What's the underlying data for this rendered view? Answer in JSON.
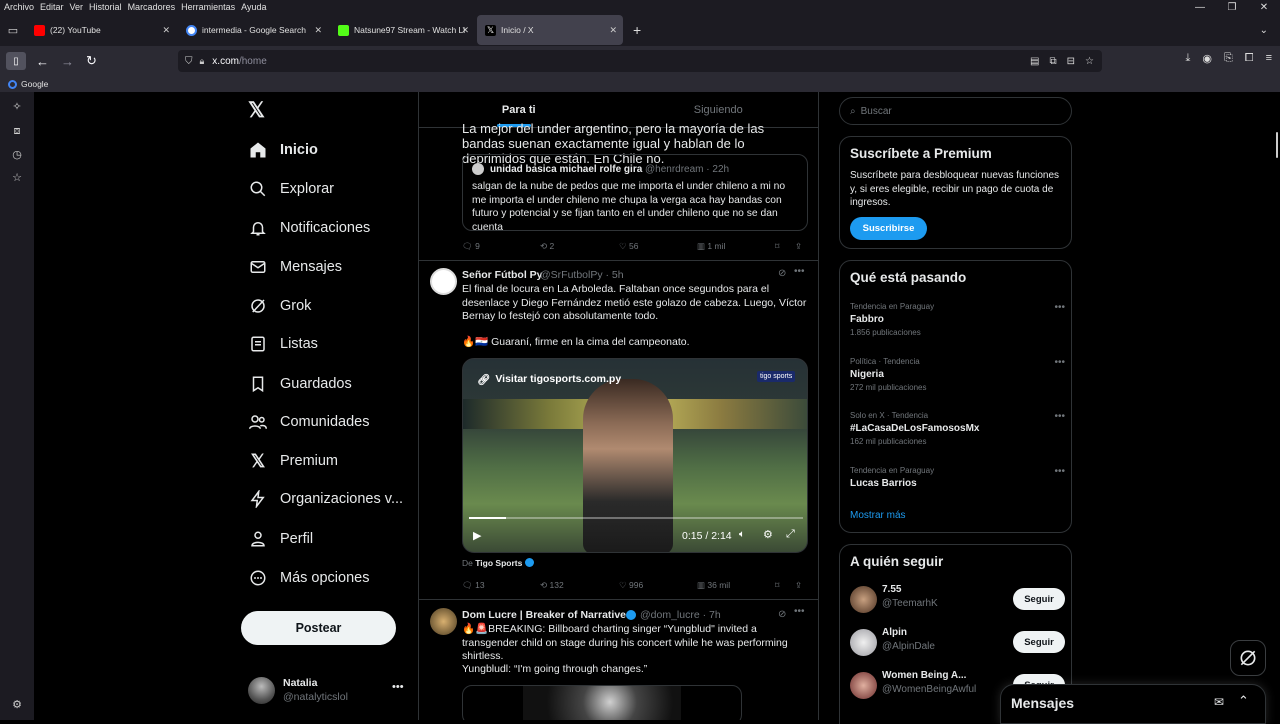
{
  "menubar": {
    "items": [
      "Archivo",
      "Editar",
      "Ver",
      "Historial",
      "Marcadores",
      "Herramientas",
      "Ayuda"
    ]
  },
  "tabs": [
    {
      "label": "(22) YouTube",
      "color": "#ff0000"
    },
    {
      "label": "intermedia - Google Search",
      "color": "#4285f4"
    },
    {
      "label": "Natsune97 Stream - Watch Live",
      "color": "#53fc18"
    },
    {
      "label": "Inicio / X",
      "color": "#ffffff"
    }
  ],
  "url": {
    "domain": "x.com",
    "path": "/home"
  },
  "bookmarks": {
    "google": "Google"
  },
  "nav": {
    "items": [
      "Inicio",
      "Explorar",
      "Notificaciones",
      "Mensajes",
      "Grok",
      "Listas",
      "Guardados",
      "Comunidades",
      "Premium",
      "Organizaciones v...",
      "Perfil",
      "Más opciones"
    ],
    "post_label": "Postear",
    "user_name": "Natalia",
    "user_handle": "@natalyticslol"
  },
  "feed": {
    "tab_for_you": "Para ti",
    "tab_following": "Siguiendo",
    "post1": {
      "text_top": "La mejor del under argentino, pero la mayoría de las bandas suenan exactamente igual y hablan de lo deprimidos que están. En Chile no.",
      "quote_name": "unidad basica michael rolfe gira",
      "quote_meta": "@henrdream · 22h",
      "quote_text": "salgan de la nube de pedos que me importa el under chileno a mi no me importa el under chileno me chupa la verga aca hay bandas con futuro y potencial y se fijan tanto en el under chileno que no se dan cuenta",
      "replies": "9",
      "reposts": "2",
      "likes": "56",
      "views": "1 mil"
    },
    "post2": {
      "name": "Señor Fútbol Py",
      "meta": "@SrFutbolPy · 5h",
      "text": "El final de locura en La Arboleda. Faltaban once segundos para el desenlace y Diego Fernández metió este golazo de cabeza. Luego, Víctor Bernay lo festejó con absolutamente todo.",
      "text2": "🔥🇵🇾 Guaraní, firme en la cima del campeonato.",
      "video_link": "Visitar tigosports.com.py",
      "video_brand": "tigo sports",
      "video_time": "0:15 / 2:14",
      "source_prefix": "De",
      "source": "Tigo Sports",
      "replies": "13",
      "reposts": "132",
      "likes": "996",
      "views": "36 mil"
    },
    "post3": {
      "name": "Dom Lucre | Breaker of Narratives",
      "meta": "@dom_lucre · 7h",
      "text": "🔥🚨BREAKING: Billboard charting singer “Yungblud\" invited a transgender child on stage during his concert while he was performing shirtless.",
      "text2": "Yungbludl: “I'm going through changes.”"
    }
  },
  "right": {
    "search_placeholder": "Buscar",
    "premium": {
      "title": "Suscríbete a Premium",
      "text": "Suscríbete para desbloquear nuevas funciones y, si eres elegible, recibir un pago de cuota de ingresos.",
      "button": "Suscribirse"
    },
    "trends_title": "Qué está pasando",
    "trends": [
      {
        "cat": "Tendencia en Paraguay",
        "name": "Fabbro",
        "count": "1.856 publicaciones"
      },
      {
        "cat": "Política · Tendencia",
        "name": "Nigeria",
        "count": "272 mil publicaciones"
      },
      {
        "cat": "Solo en X · Tendencia",
        "name": "#LaCasaDeLosFamososMx",
        "count": "162 mil publicaciones"
      },
      {
        "cat": "Tendencia en Paraguay",
        "name": "Lucas Barrios",
        "count": ""
      }
    ],
    "show_more": "Mostrar más",
    "follow_title": "A quién seguir",
    "follow": [
      {
        "name": "7.55",
        "handle": "@TeemarhK",
        "button": "Seguir"
      },
      {
        "name": "Alpin",
        "handle": "@AlpinDale",
        "button": "Seguir"
      },
      {
        "name": "Women Being A...",
        "handle": "@WomenBeingAwful",
        "button": "Seguir"
      }
    ],
    "messages": "Mensajes"
  },
  "colors": {
    "accent": "#1d9bf0",
    "bg": "#000000",
    "border": "#2f3336",
    "muted": "#71767b"
  }
}
